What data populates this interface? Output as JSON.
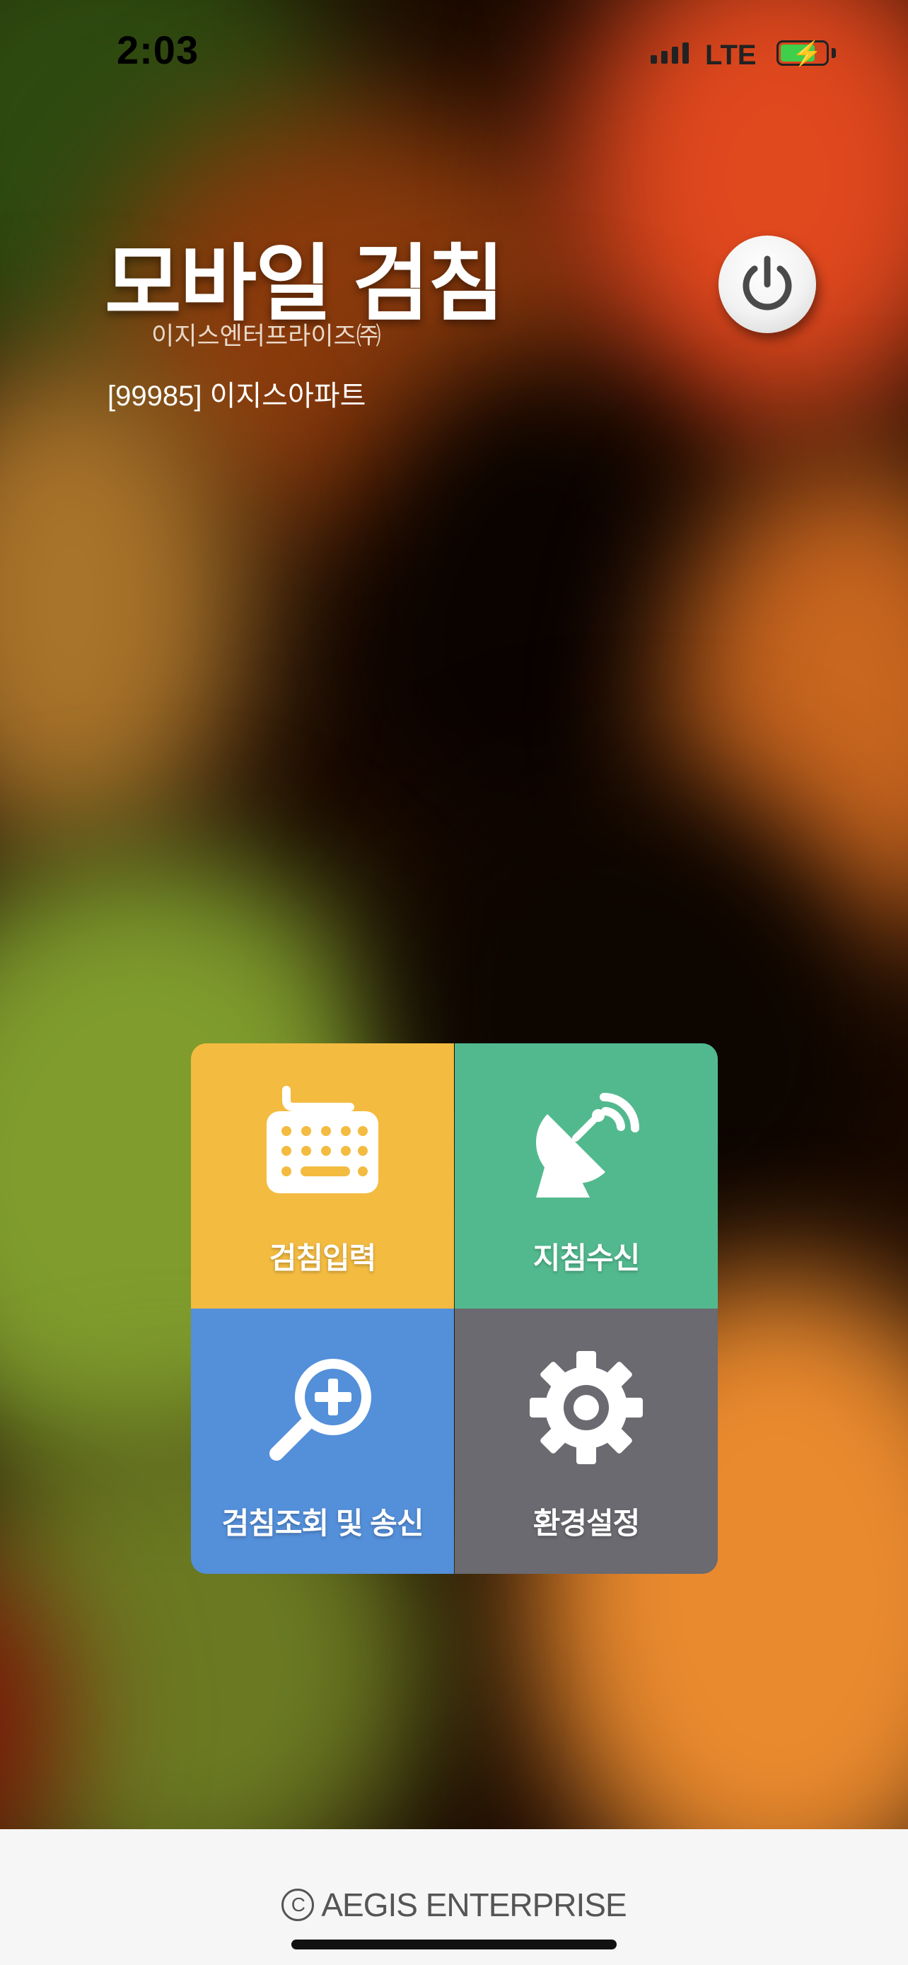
{
  "status_bar": {
    "time": "2:03",
    "network": "LTE",
    "battery_state": "charging",
    "battery_fill_fraction": 0.7
  },
  "header": {
    "title": "모바일 검침",
    "company": "이지스엔터프라이즈㈜",
    "apartment": "[99985] 이지스아파트",
    "power_icon": "power-icon"
  },
  "menu": {
    "tiles": [
      {
        "label": "검침입력",
        "icon": "keyboard-icon",
        "color": "#f3bb40"
      },
      {
        "label": "지침수신",
        "icon": "satellite-dish-icon",
        "color": "#52b98e"
      },
      {
        "label": "검침조회 및 송신",
        "icon": "search-plus-icon",
        "color": "#548fd9"
      },
      {
        "label": "환경설정",
        "icon": "gear-icon",
        "color": "#6a6a70"
      }
    ]
  },
  "footer": {
    "copyright_symbol": "C",
    "copyright": "AEGIS ENTERPRISE"
  }
}
